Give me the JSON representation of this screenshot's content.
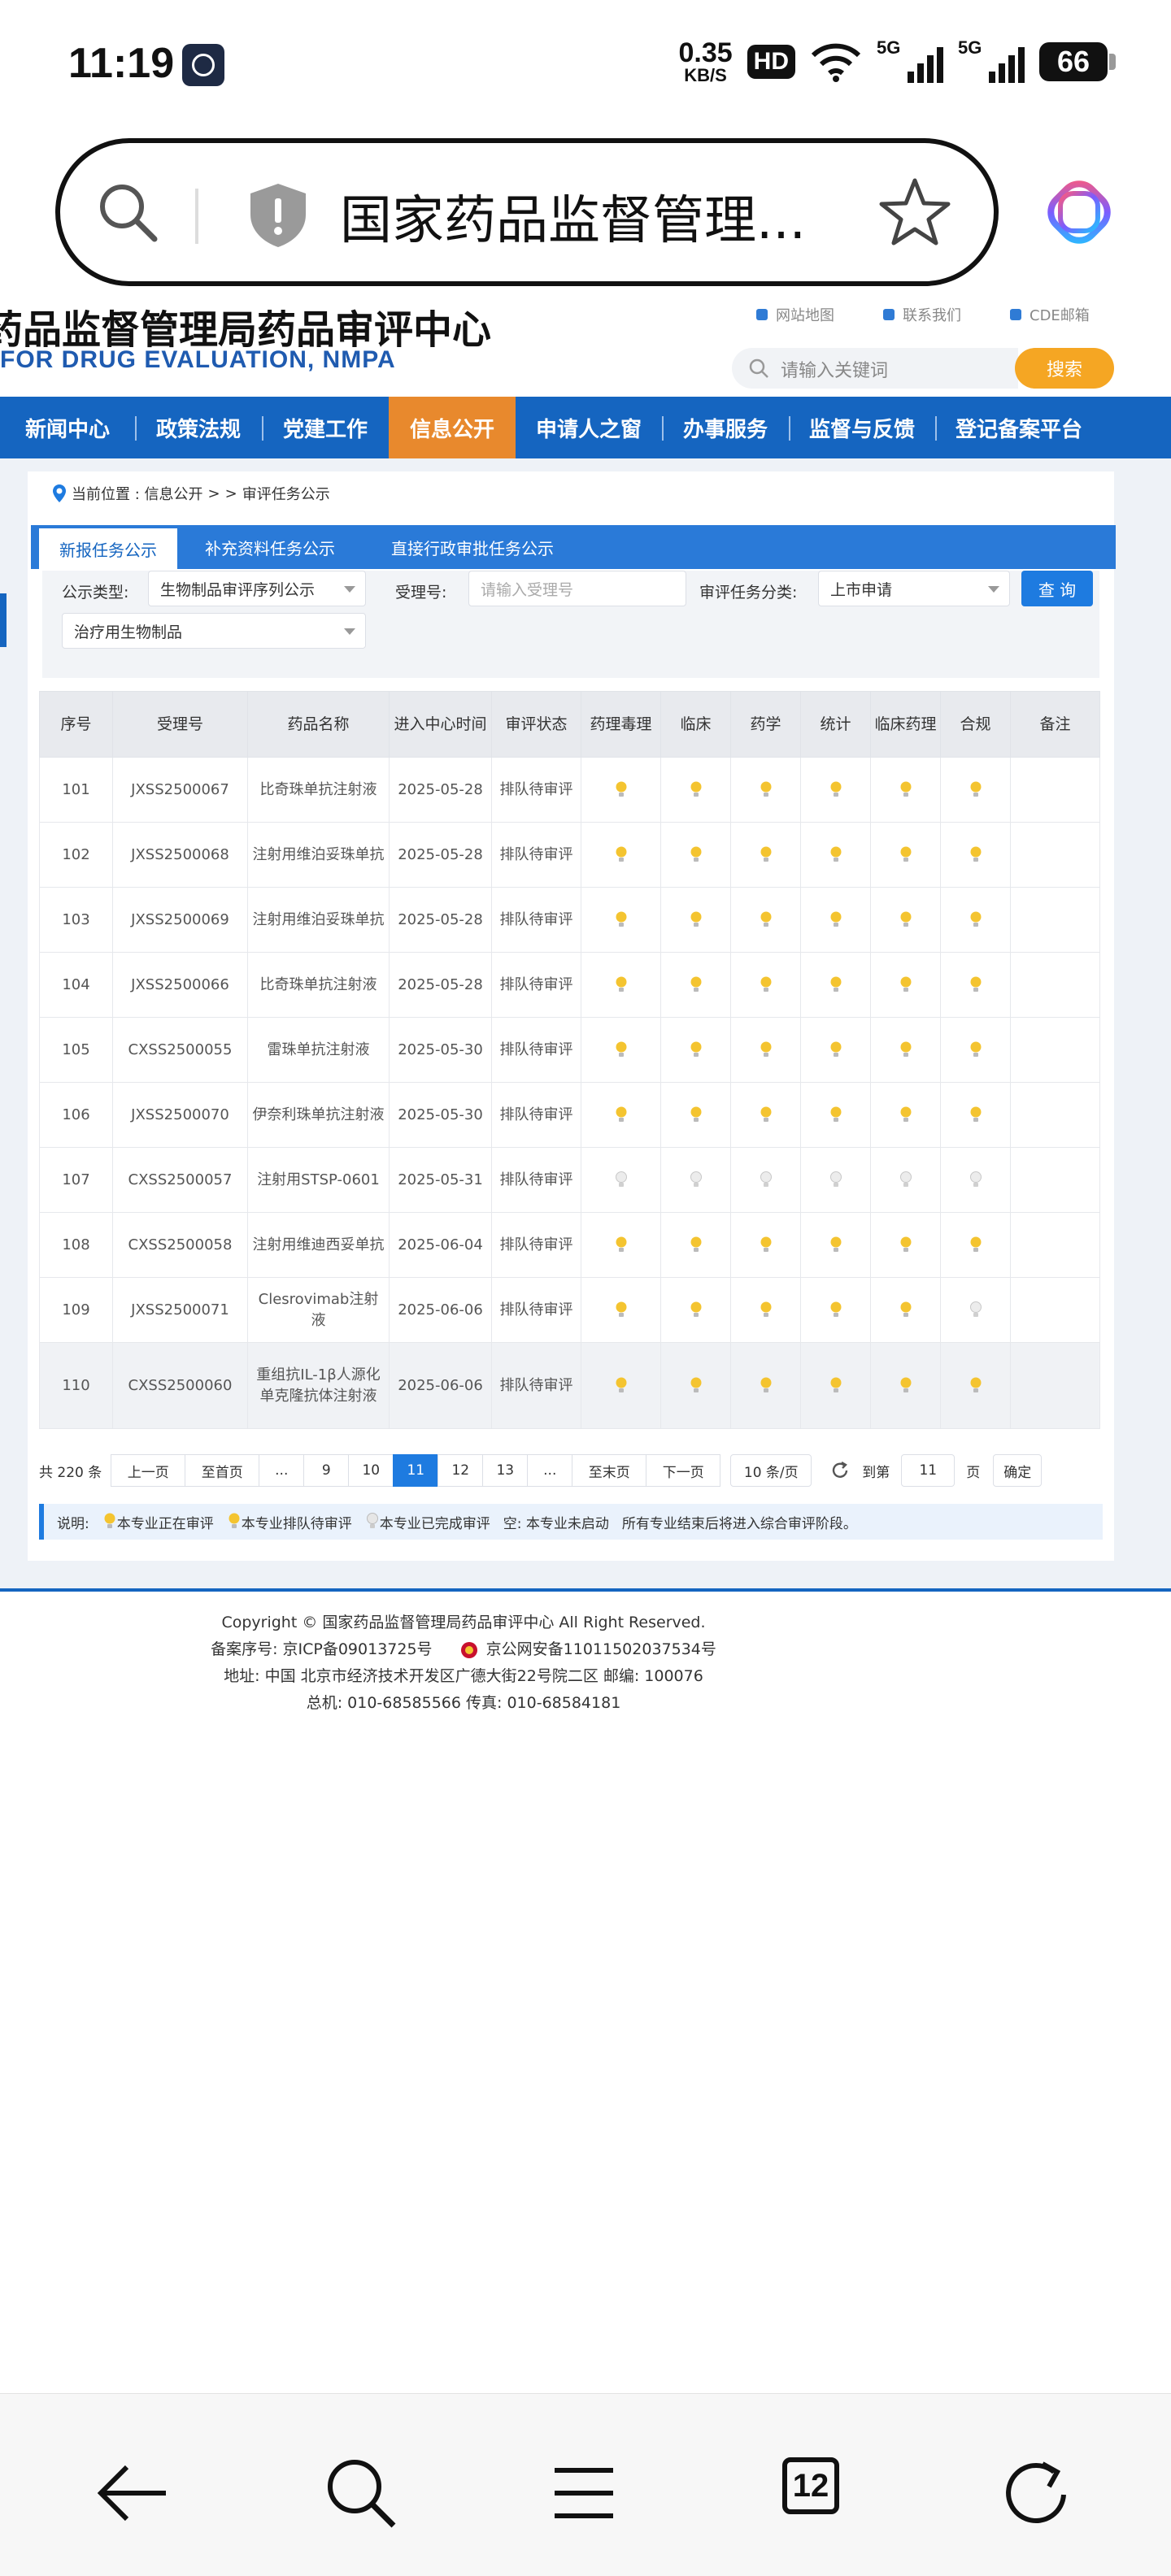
{
  "status_bar": {
    "time": "11:19",
    "net_speed_value": "0.35",
    "net_speed_unit": "KB/S",
    "hd_label": "HD",
    "signal_label": "5G",
    "battery": "66"
  },
  "browser": {
    "url_text": "国家药品监督管理...",
    "tab_count": "12"
  },
  "site": {
    "title": "药品监督管理局药品审评中心",
    "subtitle": "FOR DRUG EVALUATION, NMPA",
    "top_links": [
      "网站地图",
      "联系我们",
      "CDE邮箱"
    ],
    "search_placeholder": "请输入关键词",
    "search_button": "搜索"
  },
  "nav": [
    "新闻中心",
    "政策法规",
    "党建工作",
    "信息公开",
    "申请人之窗",
    "办事服务",
    "监督与反馈",
    "登记备案平台"
  ],
  "breadcrumb": {
    "prefix": "当前位置 : 信息公开",
    "sep": ">",
    "sep2": ">",
    "current": "审评任务公示"
  },
  "tabs": [
    "新报任务公示",
    "补充资料任务公示",
    "直接行政审批任务公示"
  ],
  "filters": {
    "type_label": "公示类型:",
    "type_value": "生物制品审评序列公示",
    "sub_type_value": "治疗用生物制品",
    "accept_label": "受理号:",
    "accept_placeholder": "请输入受理号",
    "task_label": "审评任务分类:",
    "task_value": "上市申请",
    "query_button": "查 询"
  },
  "table": {
    "headers": [
      "序号",
      "受理号",
      "药品名称",
      "进入中心时间",
      "审评状态",
      "药理毒理",
      "临床",
      "药学",
      "统计",
      "临床药理",
      "合规",
      "备注"
    ],
    "rows": [
      {
        "no": "101",
        "acc": "JXSS2500067",
        "name": "比奇珠单抗注射液",
        "date": "2025-05-28",
        "status": "排队待审评",
        "lights": [
          "y",
          "y",
          "y",
          "y",
          "y",
          "y"
        ]
      },
      {
        "no": "102",
        "acc": "JXSS2500068",
        "name": "注射用维泊妥珠单抗",
        "date": "2025-05-28",
        "status": "排队待审评",
        "lights": [
          "y",
          "y",
          "y",
          "y",
          "y",
          "y"
        ]
      },
      {
        "no": "103",
        "acc": "JXSS2500069",
        "name": "注射用维泊妥珠单抗",
        "date": "2025-05-28",
        "status": "排队待审评",
        "lights": [
          "y",
          "y",
          "y",
          "y",
          "y",
          "y"
        ]
      },
      {
        "no": "104",
        "acc": "JXSS2500066",
        "name": "比奇珠单抗注射液",
        "date": "2025-05-28",
        "status": "排队待审评",
        "lights": [
          "y",
          "y",
          "y",
          "y",
          "y",
          "y"
        ]
      },
      {
        "no": "105",
        "acc": "CXSS2500055",
        "name": "雷珠单抗注射液",
        "date": "2025-05-30",
        "status": "排队待审评",
        "lights": [
          "y",
          "y",
          "y",
          "y",
          "y",
          "y"
        ]
      },
      {
        "no": "106",
        "acc": "JXSS2500070",
        "name": "伊奈利珠单抗注射液",
        "date": "2025-05-30",
        "status": "排队待审评",
        "lights": [
          "y",
          "y",
          "y",
          "y",
          "y",
          "y"
        ]
      },
      {
        "no": "107",
        "acc": "CXSS2500057",
        "name": "注射用STSP-0601",
        "date": "2025-05-31",
        "status": "排队待审评",
        "lights": [
          "w",
          "w",
          "w",
          "w",
          "w",
          "w"
        ]
      },
      {
        "no": "108",
        "acc": "CXSS2500058",
        "name": "注射用维迪西妥单抗",
        "date": "2025-06-04",
        "status": "排队待审评",
        "lights": [
          "y",
          "y",
          "y",
          "y",
          "y",
          "y"
        ]
      },
      {
        "no": "109",
        "acc": "JXSS2500071",
        "name": "Clesrovimab注射液",
        "date": "2025-06-06",
        "status": "排队待审评",
        "lights": [
          "y",
          "y",
          "y",
          "y",
          "y",
          "w"
        ]
      },
      {
        "no": "110",
        "acc": "CXSS2500060",
        "name": "重组抗IL-1β人源化单克隆抗体注射液",
        "date": "2025-06-06",
        "status": "排队待审评",
        "lights": [
          "y",
          "y",
          "y",
          "y",
          "y",
          "y"
        ]
      }
    ]
  },
  "pager": {
    "total": "共 220 条",
    "prev": "上一页",
    "first": "至首页",
    "ellipsis": "...",
    "p9": "9",
    "p10": "10",
    "p11": "11",
    "p12": "12",
    "p13": "13",
    "last": "至末页",
    "next": "下一页",
    "per_page": "10 条/页",
    "goto_label": "到第",
    "goto_value": "11",
    "page_unit": "页",
    "confirm": "确定"
  },
  "legend": {
    "label": "说明:",
    "reviewing": "本专业正在审评",
    "queued": "本专业排队待审评",
    "done": "本专业已完成审评",
    "empty": "空: 本专业未启动",
    "note": "所有专业结束后将进入综合审评阶段。"
  },
  "footer": {
    "copyright": "Copyright © 国家药品监督管理局药品审评中心   All Right Reserved.",
    "icp": "备案序号: 京ICP备09013725号",
    "police": "京公网安备11011502037534号",
    "address": "地址: 中国 北京市经济技术开发区广德大街22号院二区      邮编: 100076",
    "phone": "总机: 010-68585566      传真: 010-68584181"
  },
  "colors": {
    "brand_blue": "#1565c0",
    "active_orange": "#e8892d",
    "search_orange": "#f5a623",
    "bulb_yellow": "#f4c430"
  },
  "icons": [
    "search-icon",
    "shield-icon",
    "star-icon",
    "back-icon",
    "menu-icon",
    "refresh-icon",
    "bulb-icon",
    "location-pin-icon"
  ]
}
